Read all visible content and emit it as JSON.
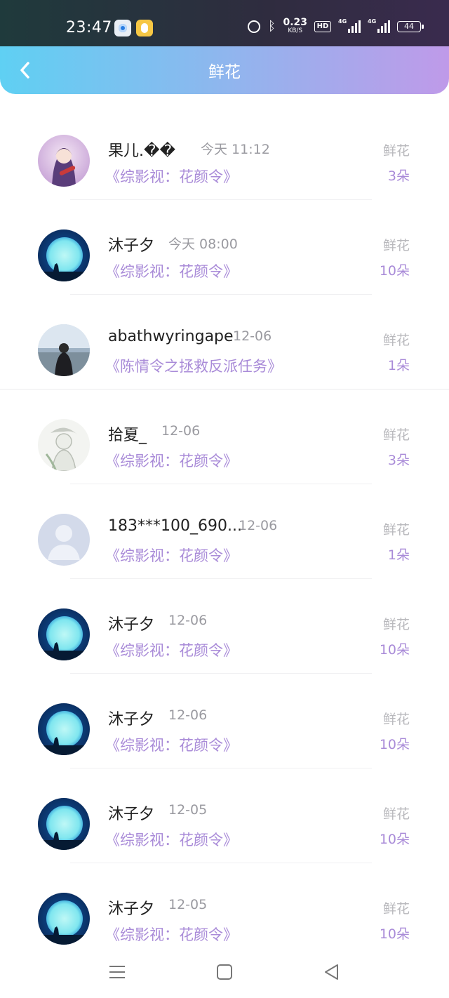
{
  "status_bar": {
    "time": "23:47",
    "net_speed_value": "0.23",
    "net_speed_unit": "KB/S",
    "hd_label": "HD",
    "sim1_label": "4G",
    "sim2_label": "4G",
    "battery": "44",
    "icons": [
      "browser-app-icon",
      "rabbit-app-icon",
      "alarm-icon",
      "bluetooth-icon",
      "hd-icon",
      "signal-icon",
      "signal-icon",
      "battery-icon"
    ]
  },
  "header": {
    "title": "鲜花",
    "back_icon": "chevron-left-icon",
    "gradient": [
      "#5fd0f3",
      "#8fb6ee",
      "#bf9ae9"
    ]
  },
  "colors": {
    "accent": "#a98bd8",
    "muted": "#9a9aa0"
  },
  "records": [
    {
      "name": "果儿.��",
      "date": "今天 11:12",
      "work": "《综影视：花颜令》",
      "kind": "鲜花",
      "count": "3朵",
      "avatar": "anime-girl"
    },
    {
      "name": "沐子夕",
      "date": "今天 08:00",
      "work": "《综影视：花颜令》",
      "kind": "鲜花",
      "count": "10朵",
      "avatar": "moon"
    },
    {
      "name": "abathwyringape",
      "date": "12-06",
      "work": "《陈情令之拯救反派任务》",
      "kind": "鲜花",
      "count": "1朵",
      "avatar": "photo-man"
    },
    {
      "name": "拾夏_",
      "date": "12-06",
      "work": "《综影视：花颜令》",
      "kind": "鲜花",
      "count": "3朵",
      "avatar": "sketch"
    },
    {
      "name": "183***100_690...",
      "date": "12-06",
      "work": "《综影视：花颜令》",
      "kind": "鲜花",
      "count": "1朵",
      "avatar": "default"
    },
    {
      "name": "沐子夕",
      "date": "12-06",
      "work": "《综影视：花颜令》",
      "kind": "鲜花",
      "count": "10朵",
      "avatar": "moon"
    },
    {
      "name": "沐子夕",
      "date": "12-06",
      "work": "《综影视：花颜令》",
      "kind": "鲜花",
      "count": "10朵",
      "avatar": "moon"
    },
    {
      "name": "沐子夕",
      "date": "12-05",
      "work": "《综影视：花颜令》",
      "kind": "鲜花",
      "count": "10朵",
      "avatar": "moon"
    },
    {
      "name": "沐子夕",
      "date": "12-05",
      "work": "《综影视：花颜令》",
      "kind": "鲜花",
      "count": "10朵",
      "avatar": "moon"
    }
  ],
  "nav_bar": {
    "icons": [
      "menu-icon",
      "home-icon",
      "back-triangle-icon"
    ]
  }
}
